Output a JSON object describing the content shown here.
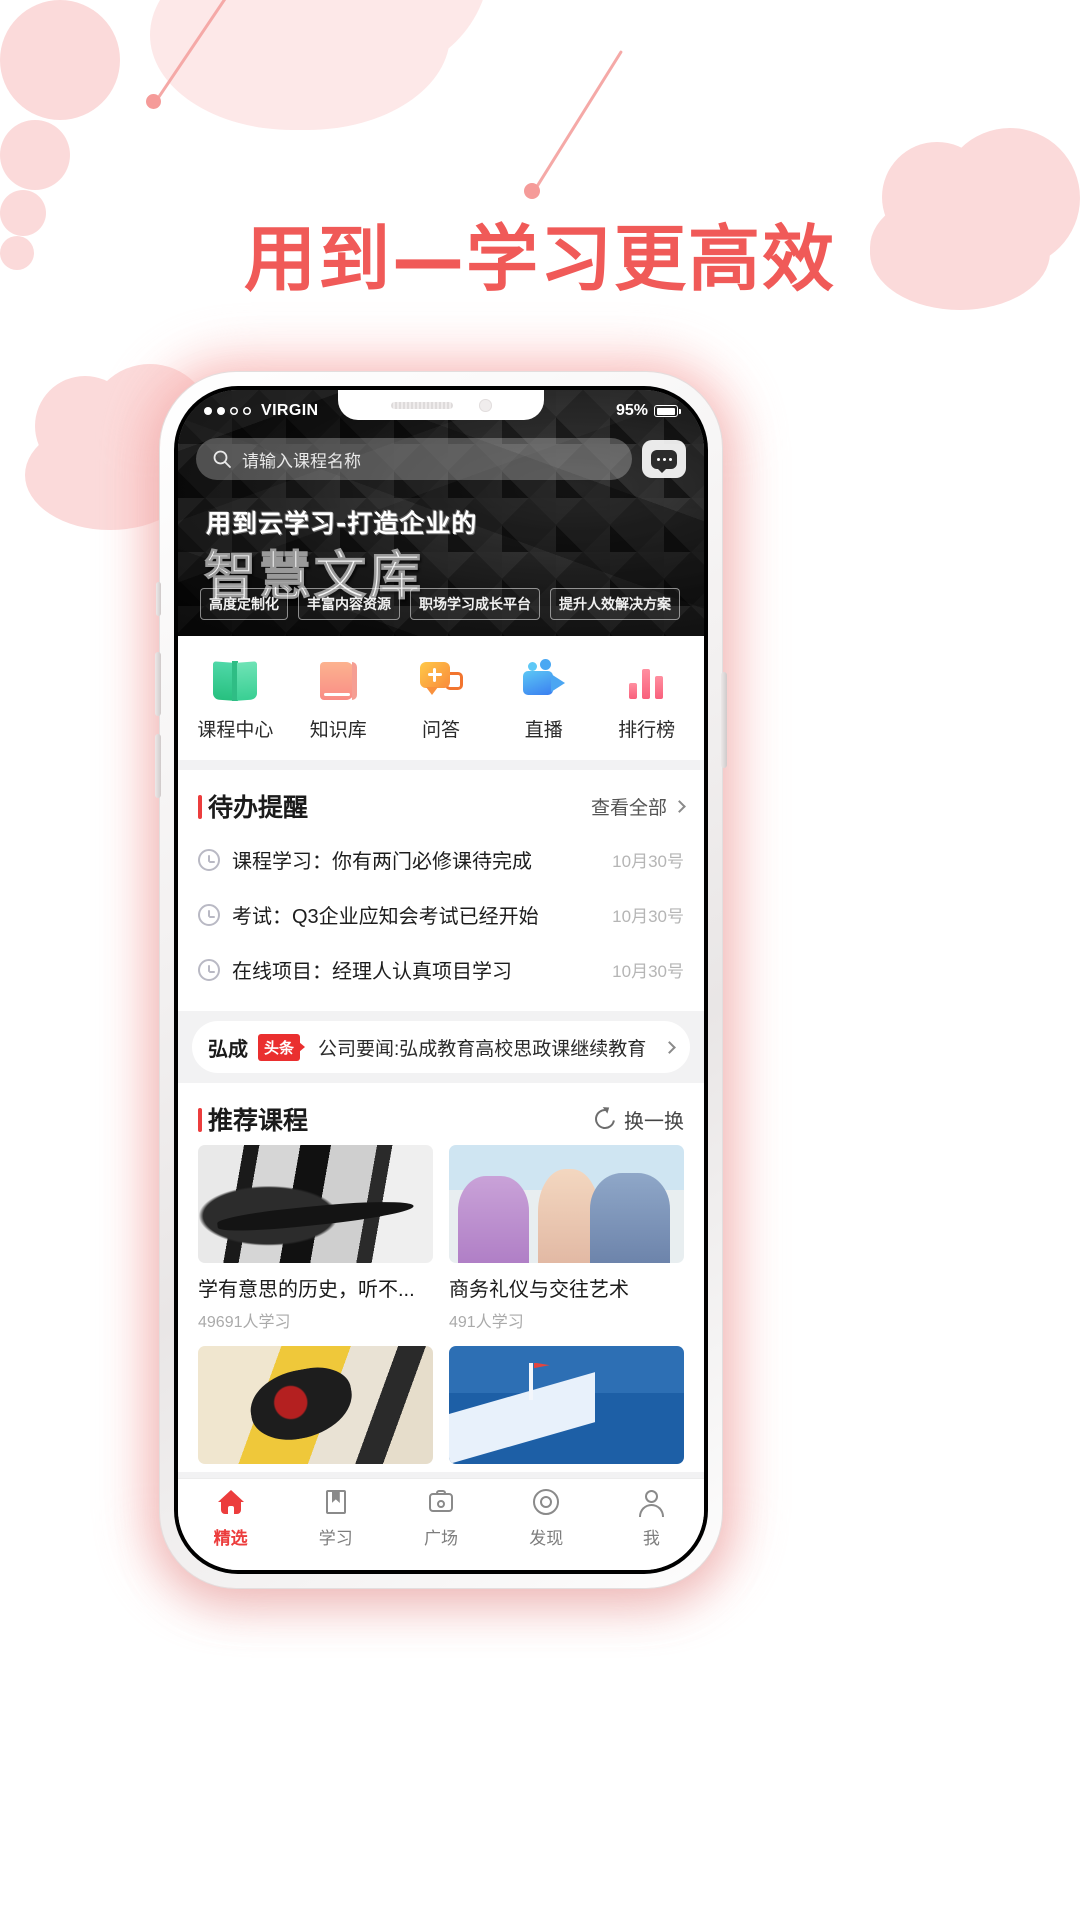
{
  "page": {
    "headline": "用到—学习更高效",
    "accent_color": "#f05a58",
    "brand_red": "#ec3d3d"
  },
  "status_bar": {
    "carrier": "VIRGIN",
    "signal_dots": 4,
    "signal_filled": 2,
    "battery_text": "95%"
  },
  "search": {
    "placeholder": "请输入课程名称",
    "icon": "search-icon",
    "message_icon": "message-bubble-icon"
  },
  "banner": {
    "line1": "用到云学习-打造企业的",
    "line2": "智慧文库",
    "tags": [
      "高度定制化",
      "丰富内容资源",
      "职场学习成长平台",
      "提升人效解决方案"
    ]
  },
  "quick_nav": [
    {
      "label": "课程中心",
      "icon": "open-book-icon",
      "color": "#2fbd85"
    },
    {
      "label": "知识库",
      "icon": "closed-book-icon",
      "color": "#f98c86"
    },
    {
      "label": "问答",
      "icon": "question-bubble-icon",
      "color": "#f9913d"
    },
    {
      "label": "直播",
      "icon": "video-camera-icon",
      "color": "#4ba6f2"
    },
    {
      "label": "排行榜",
      "icon": "bar-chart-icon",
      "color": "#f9607c"
    }
  ],
  "todo": {
    "title": "待办提醒",
    "more_label": "查看全部",
    "items": [
      {
        "text": "课程学习：你有两门必修课待完成",
        "date": "10月30号",
        "icon": "clock-icon"
      },
      {
        "text": "考试：Q3企业应知会考试已经开始",
        "date": "10月30号",
        "icon": "clock-icon"
      },
      {
        "text": "在线项目：经理人认真项目学习",
        "date": "10月30号",
        "icon": "clock-icon"
      }
    ]
  },
  "news": {
    "brand": "弘成",
    "badge": "头条",
    "text": "公司要闻:弘成教育高校思政课继续教育"
  },
  "recommend": {
    "title": "推荐课程",
    "refresh_label": "换一换",
    "refresh_icon": "refresh-icon",
    "courses": [
      {
        "name": "学有意思的历史，听不...",
        "learners": "49691人学习",
        "art": "art-ink"
      },
      {
        "name": "商务礼仪与交往艺术",
        "learners": "491人学习",
        "art": "art-office"
      },
      {
        "name": "",
        "learners": "",
        "art": "art-paint"
      },
      {
        "name": "",
        "learners": "",
        "art": "art-team"
      }
    ]
  },
  "tabbar": [
    {
      "label": "精选",
      "icon": "home-icon",
      "active": true
    },
    {
      "label": "学习",
      "icon": "book-icon",
      "active": false
    },
    {
      "label": "广场",
      "icon": "camera-icon",
      "active": false
    },
    {
      "label": "发现",
      "icon": "compass-icon",
      "active": false
    },
    {
      "label": "我",
      "icon": "person-icon",
      "active": false
    }
  ]
}
